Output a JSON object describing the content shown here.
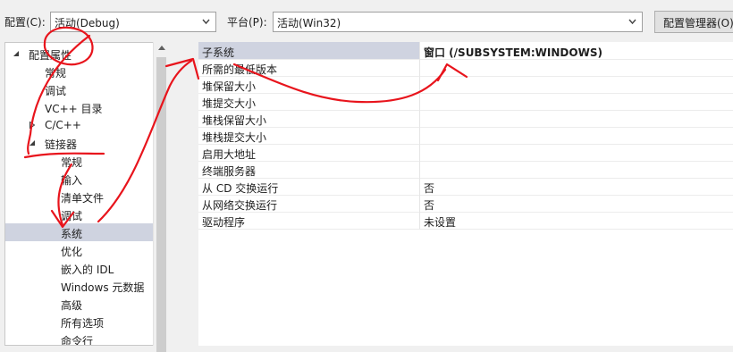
{
  "toolbar": {
    "config_label": "配置(C):",
    "config_value": "活动(Debug)",
    "platform_label": "平台(P):",
    "platform_value": "活动(Win32)",
    "config_manager_label": "配置管理器(O)"
  },
  "tree": {
    "items": [
      {
        "label": "配置属性",
        "expander": "expanded"
      },
      {
        "label": "常规",
        "expander": "none"
      },
      {
        "label": "调试",
        "expander": "none"
      },
      {
        "label": "VC++ 目录",
        "expander": "none"
      },
      {
        "label": "C/C++",
        "expander": "collapsed"
      },
      {
        "label": "链接器",
        "expander": "expanded"
      },
      {
        "label": "常规",
        "expander": "none"
      },
      {
        "label": "输入",
        "expander": "none"
      },
      {
        "label": "清单文件",
        "expander": "none"
      },
      {
        "label": "调试",
        "expander": "none"
      },
      {
        "label": "系统",
        "expander": "none",
        "selected": true
      },
      {
        "label": "优化",
        "expander": "none"
      },
      {
        "label": "嵌入的 IDL",
        "expander": "none"
      },
      {
        "label": "Windows 元数据",
        "expander": "none"
      },
      {
        "label": "高级",
        "expander": "none"
      },
      {
        "label": "所有选项",
        "expander": "none"
      },
      {
        "label": "命令行",
        "expander": "none"
      }
    ]
  },
  "properties": {
    "rows": [
      {
        "name": "子系统",
        "value": "窗口 (/SUBSYSTEM:WINDOWS)",
        "selected": true
      },
      {
        "name": "所需的最低版本",
        "value": ""
      },
      {
        "name": "堆保留大小",
        "value": ""
      },
      {
        "name": "堆提交大小",
        "value": ""
      },
      {
        "name": "堆栈保留大小",
        "value": ""
      },
      {
        "name": "堆栈提交大小",
        "value": ""
      },
      {
        "name": "启用大地址",
        "value": ""
      },
      {
        "name": "终端服务器",
        "value": ""
      },
      {
        "name": "从 CD 交换运行",
        "value": "否"
      },
      {
        "name": "从网络交换运行",
        "value": "否"
      },
      {
        "name": "驱动程序",
        "value": "未设置"
      }
    ]
  },
  "icons": {
    "dropdown": "chevron-down-icon",
    "tree_expanded": "triangle-expanded-icon",
    "tree_collapsed": "triangle-collapsed-icon",
    "scroll_up": "scroll-up-arrow-icon"
  },
  "colors": {
    "selection": "#cfd3e0",
    "annotation_ink": "#e8141c",
    "window_bg": "#f0f0f0"
  }
}
